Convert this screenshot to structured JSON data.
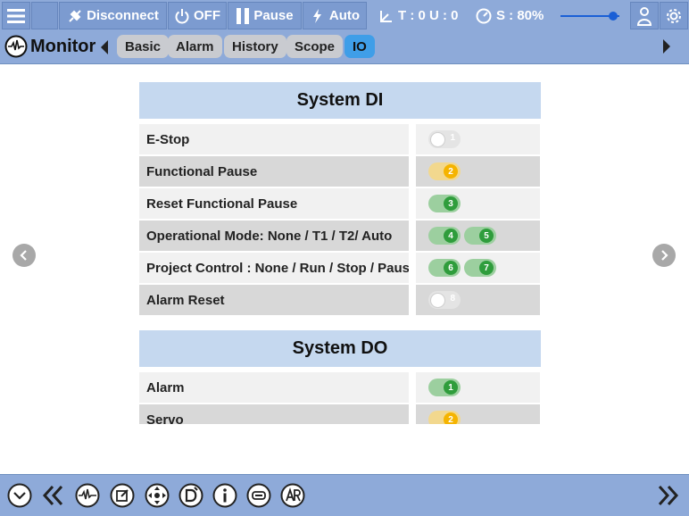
{
  "topbar": {
    "disconnect_label": "Disconnect",
    "power_label": "OFF",
    "pause_label": "Pause",
    "auto_label": "Auto",
    "t_status": "T : 0 U : 0",
    "speed_label": "S : 80%",
    "speed_value": 0.8
  },
  "subbar": {
    "title": "Monitor",
    "tabs": [
      {
        "label": "Basic",
        "active": false
      },
      {
        "label": "Alarm",
        "active": false
      },
      {
        "label": "History",
        "active": false
      },
      {
        "label": "Scope",
        "active": false
      },
      {
        "label": "IO",
        "active": true
      }
    ]
  },
  "system_di": {
    "title": "System DI",
    "rows": [
      {
        "label": "E-Stop",
        "signals": [
          {
            "num": "1",
            "state": "off"
          }
        ]
      },
      {
        "label": "Functional Pause",
        "signals": [
          {
            "num": "2",
            "state": "yellow"
          }
        ]
      },
      {
        "label": "Reset Functional Pause",
        "signals": [
          {
            "num": "3",
            "state": "green"
          }
        ]
      },
      {
        "label": "Operational Mode: None / T1 / T2/ Auto",
        "signals": [
          {
            "num": "4",
            "state": "green"
          },
          {
            "num": "5",
            "state": "green"
          }
        ]
      },
      {
        "label": "Project Control : None / Run / Stop / Pause",
        "signals": [
          {
            "num": "6",
            "state": "green"
          },
          {
            "num": "7",
            "state": "green"
          }
        ]
      },
      {
        "label": "Alarm Reset",
        "signals": [
          {
            "num": "8",
            "state": "off"
          }
        ]
      }
    ]
  },
  "system_do": {
    "title": "System DO",
    "rows": [
      {
        "label": "Alarm",
        "signals": [
          {
            "num": "1",
            "state": "green"
          }
        ]
      },
      {
        "label": "Servo",
        "signals": [
          {
            "num": "2",
            "state": "yellow"
          }
        ]
      }
    ]
  },
  "colors": {
    "bar_bg": "#8eaad9",
    "section_head": "#c5d8ef",
    "active_tab": "#3f9ee8",
    "signal_green": "#2f9d3c",
    "signal_yellow": "#f5b400"
  },
  "bottombar": {
    "icons": [
      "chevron-down-icon",
      "double-chevron-left-icon",
      "waveform-icon",
      "edit-icon",
      "jog-move-icon",
      "program-d-icon",
      "info-icon",
      "transfer-icon",
      "ar-icon",
      "double-chevron-right-icon"
    ]
  }
}
